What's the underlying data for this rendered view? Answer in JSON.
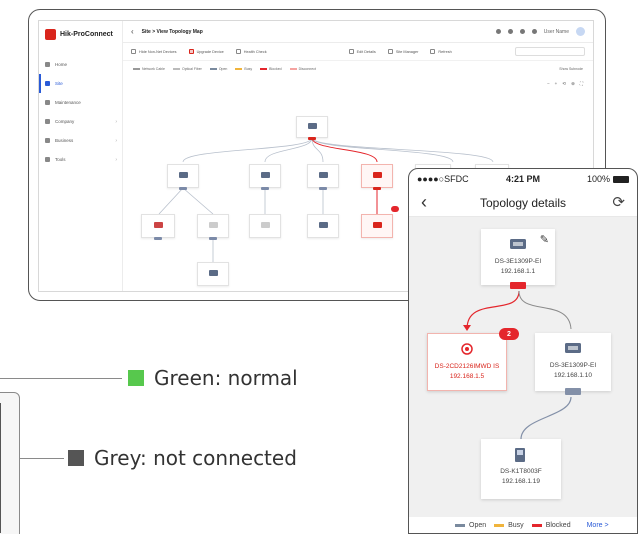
{
  "legend": {
    "items": [
      {
        "label": "Green: normal",
        "color": "#57c84d"
      },
      {
        "label": "Grey: not connected",
        "color": "#555555"
      }
    ]
  },
  "desktop": {
    "logo": "Hik-ProConnect",
    "title": "Site > View Topology Map",
    "user": "User Name",
    "nav": [
      {
        "label": "Home",
        "active": false,
        "icon": "home-icon"
      },
      {
        "label": "Site",
        "active": true,
        "icon": "site-icon"
      },
      {
        "label": "Maintenance",
        "active": false,
        "icon": "maintenance-icon"
      },
      {
        "label": "Company",
        "active": false,
        "icon": "company-icon",
        "arrow": true
      },
      {
        "label": "Business",
        "active": false,
        "icon": "business-icon",
        "arrow": true
      },
      {
        "label": "Tools",
        "active": false,
        "icon": "tools-icon",
        "arrow": true
      }
    ],
    "toolbar": {
      "hide_virtual": "Hide Non-Net Devices",
      "upgrade": "Upgrade Device",
      "health": "Health Check",
      "edit_name": "Edit Details",
      "site_manager": "Site Manager",
      "refresh": "Refresh"
    },
    "legend": {
      "network_cable": "Network Cable",
      "optical_fiber": "Optical Fiber",
      "open": "Open",
      "busy": "Busy",
      "blocked": "Blocked",
      "disconnect": "Disconnect",
      "show_subnode": "Show Subnode"
    },
    "zoom": [
      "−",
      "+",
      "⟲",
      "⊕",
      "⛶"
    ]
  },
  "phone": {
    "carrier": "●●●●○SFDC",
    "time": "4:21 PM",
    "battery": "100%",
    "title": "Topology details",
    "nodes": {
      "root": {
        "name": "DS-3E1309P-EI",
        "ip": "192.168.1.1"
      },
      "alarm": {
        "name": "DS-2CD2126IMWD IS",
        "ip": "192.168.1.5",
        "badge": "2"
      },
      "switch": {
        "name": "DS-3E1309P-EI",
        "ip": "192.168.1.10"
      },
      "nvr": {
        "name": "DS-K1T8003F",
        "ip": "192.168.1.19"
      }
    },
    "bottom": {
      "open": "Open",
      "busy": "Busy",
      "blocked": "Blocked",
      "more": "More >"
    },
    "colors": {
      "open": "#7a8a9e",
      "busy": "#f0b43c",
      "blocked": "#e4262c"
    }
  }
}
